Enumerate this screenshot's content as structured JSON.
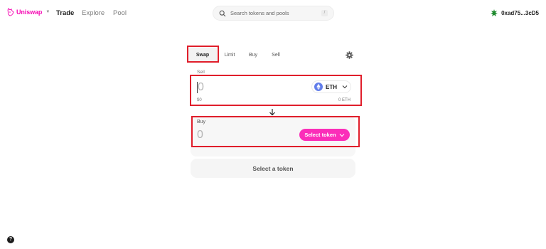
{
  "brand": {
    "name": "Uniswap",
    "color": "#f50db4"
  },
  "nav": {
    "links": [
      "Trade",
      "Explore",
      "Pool"
    ],
    "active": "Trade"
  },
  "search": {
    "placeholder": "Search tokens and pools",
    "shortcut": "/"
  },
  "wallet": {
    "address": "0xad75...3cD5"
  },
  "tabs": [
    "Swap",
    "Limit",
    "Buy",
    "Sell"
  ],
  "active_tab": "Swap",
  "sell": {
    "label": "Sell",
    "amount_placeholder": "0",
    "token": "ETH",
    "usd_value": "$0",
    "balance": "0 ETH"
  },
  "buy": {
    "label": "Buy",
    "amount_placeholder": "0",
    "select_label": "Select token"
  },
  "action_button": {
    "label": "Select a token"
  },
  "help": {
    "label": "?"
  },
  "colors": {
    "accent": "#fb2eb9",
    "highlight": "#e01e2b",
    "eth": "#627eea"
  },
  "icons": [
    "uniswap-logo-icon",
    "search-icon",
    "wallet-avatar-icon",
    "settings-gear-icon",
    "eth-icon",
    "chevron-down-icon",
    "arrow-down-icon",
    "help-icon"
  ]
}
